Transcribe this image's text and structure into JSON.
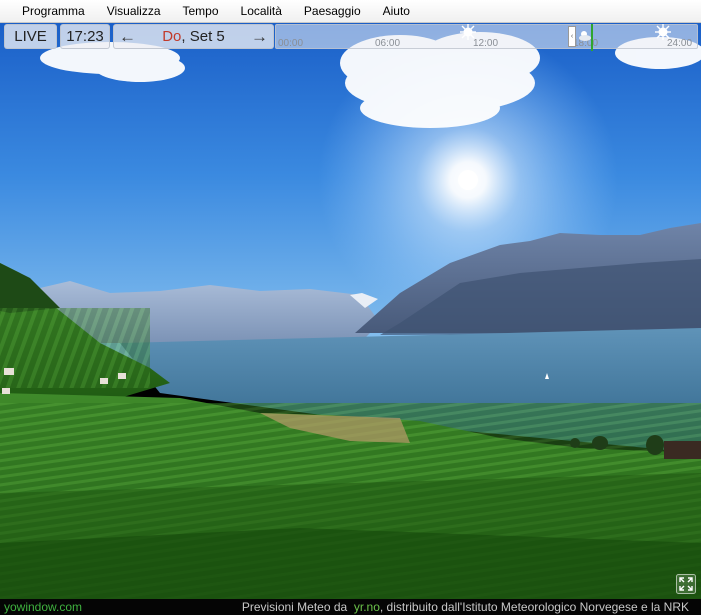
{
  "menu": [
    "Programma",
    "Visualizza",
    "Tempo",
    "Località",
    "Paesaggio",
    "Aiuto"
  ],
  "toolbar": {
    "live_label": "LIVE",
    "time": "17:23",
    "date_day": "Do",
    "date_rest": ", Set 5",
    "prev_arrow": "←",
    "next_arrow": "→"
  },
  "timeline": {
    "ticks": [
      "00:00",
      "06:00",
      "12:00",
      "18:00",
      "24:00"
    ],
    "current_time": "17:23"
  },
  "status": {
    "brand": "yowindow.com",
    "credits_prefix": "Previsioni Meteo da",
    "credits_link": "yr.no",
    "credits_suffix": ", distribuito dall'Istituto Meteorologico Norvegese e la NRK"
  },
  "colors": {
    "accent_day": "#c23a2a",
    "brand_green": "#3fb23f",
    "cursor_green": "#2fa52f",
    "sky_top": "#1a5fc8",
    "lake": "#3a6f96"
  },
  "icons": [
    "prev-arrow-icon",
    "next-arrow-icon",
    "sun-icon",
    "cloudy-icon",
    "fullscreen-icon"
  ]
}
